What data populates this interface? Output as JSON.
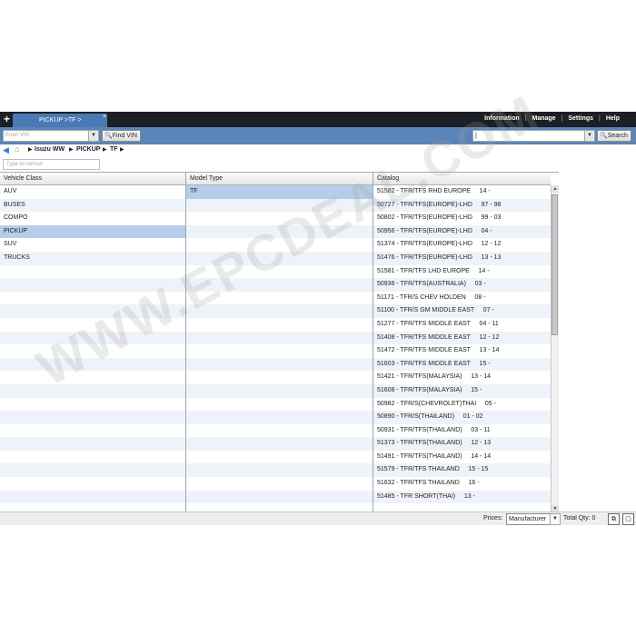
{
  "tab": {
    "label": "PICKUP >TF >",
    "close": "×"
  },
  "menu": [
    "Information",
    "Manage",
    "Settings",
    "Help"
  ],
  "vin": {
    "placeholder": "Enter VIN",
    "find_label": "Find VIN"
  },
  "search": {
    "value": "|",
    "button_label": "Search"
  },
  "breadcrumb": [
    "Isuzu WW",
    "PICKUP",
    "TF"
  ],
  "filter_placeholder": "Type to narrow",
  "columns": {
    "vehicle_class": "Vehicle Class",
    "model_type": "Model Type",
    "catalog": "Catalog"
  },
  "vehicle_classes": [
    "AUV",
    "BUSES",
    "COMPO",
    "PICKUP",
    "SUV",
    "TRUCKS"
  ],
  "selected_vehicle_class": "PICKUP",
  "model_types": [
    "TF"
  ],
  "catalog": [
    "51582 - TFR/TFS RHD EUROPE     14 -",
    "50727 - TFR/TFS(EUROPE)-LHD     97 - 98",
    "50802 - TFR/TFS(EUROPE)-LHD     99 - 03",
    "50956 - TFR/TFS(EUROPE)-LHD     04 -",
    "51374 - TFR/TFS(EUROPE)-LHD     12 - 12",
    "51476 - TFR/TFS(EUROPE)-LHD     13 - 13",
    "51581 - TFR/TFS LHD EUROPE     14 -",
    "50936 - TFR/TFS(AUSTRALIA)     03 -",
    "51171 - TFR/S CHEV HOLDEN     08 -",
    "51100 - TFR/S GM MIDDLE EAST     07 -",
    "51277 - TFR/TFS MIDDLE EAST     04 - 11",
    "51408 - TFR/TFS MIDDLE EAST     12 - 12",
    "51472 - TFR/TFS MIDDLE EAST     13 - 14",
    "51603 - TFR/TFS MIDDLE EAST     15 -",
    "51421 - TFR/TFS(MALAYSIA)     13 - 14",
    "51608 - TFR/TFS(MALAYSIA)     15 -",
    "50982 - TFR/S(CHEVROLET)THAI     05 -",
    "50890 - TFR/S(THAILAND)     01 - 02",
    "50931 - TFR/TFS(THAILAND)     03 - 11",
    "51373 - TFR/TFS(THAILAND)     12 - 13",
    "51491 - TFR/TFS(THAILAND)     14 - 14",
    "51579 - TFR/TFS THAILAND     15 - 15",
    "51632 - TFR/TFS THAILAND     16 -",
    "51485 - TFR SHORT(THAI)     13 -"
  ],
  "status": {
    "prices_label": "Prices:",
    "prices_value": "Manufacturer",
    "total_qty": "Total Qty: 0"
  },
  "watermark": "WWW.EPCDEAL.COM",
  "colors": {
    "topbar": "#1d1f24",
    "tab": "#4a7ab3",
    "vinbar": "#5b84b8",
    "selected_row": "#b6cdea",
    "alt_row": "#eef3fa"
  }
}
